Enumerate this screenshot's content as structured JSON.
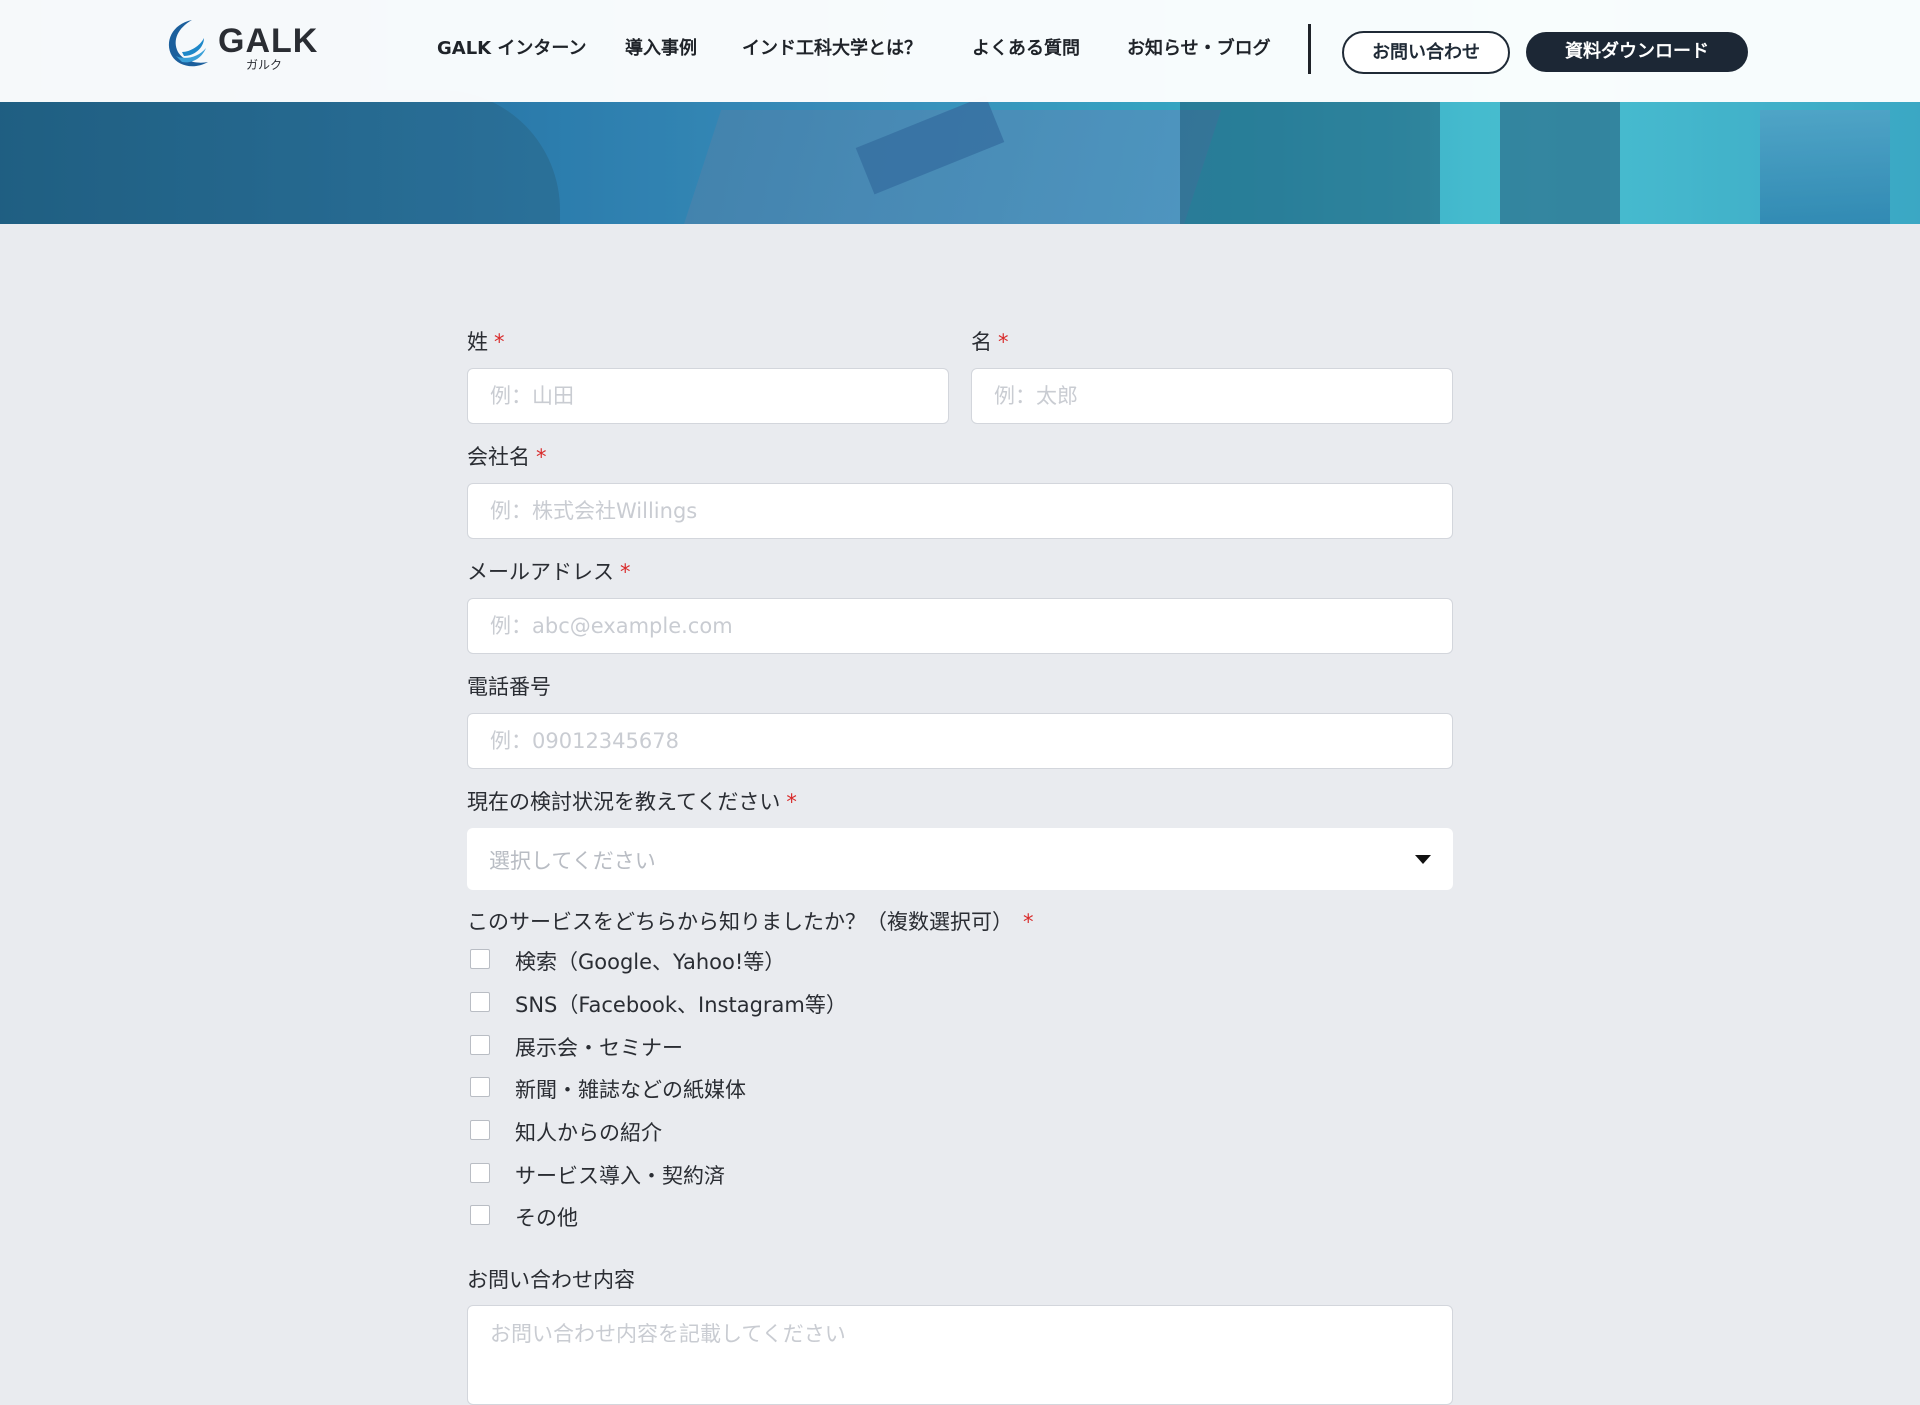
{
  "header": {
    "logo_text": "GALK",
    "logo_sub": "ガルク",
    "nav": [
      {
        "label": "GALK インターン"
      },
      {
        "label": "導入事例"
      },
      {
        "label": "インド工科大学とは？"
      },
      {
        "label": "よくある質問"
      },
      {
        "label": "お知らせ・ブログ"
      }
    ],
    "contact_label": "お問い合わせ",
    "download_label": "資料ダウンロード"
  },
  "form": {
    "last_name": {
      "label": "姓",
      "required": "*",
      "placeholder": "例：山田"
    },
    "first_name": {
      "label": "名",
      "required": "*",
      "placeholder": "例：太郎"
    },
    "company": {
      "label": "会社名",
      "required": "*",
      "placeholder": "例：株式会社Willings"
    },
    "email": {
      "label": "メールアドレス",
      "required": "*",
      "placeholder": "例：abc@example.com"
    },
    "phone": {
      "label": "電話番号",
      "placeholder": "例：09012345678"
    },
    "status": {
      "label": "現在の検討状況を教えてください",
      "required": "*",
      "placeholder": "選択してください"
    },
    "source": {
      "label": "このサービスをどちらから知りましたか？（複数選択可）",
      "required": "*",
      "options": [
        {
          "label": "検索（Google、Yahoo!等）",
          "checked": false
        },
        {
          "label": "SNS（Facebook、Instagram等）",
          "checked": false
        },
        {
          "label": "展示会・セミナー",
          "checked": false
        },
        {
          "label": "新聞・雑誌などの紙媒体",
          "checked": false
        },
        {
          "label": "知人からの紹介",
          "checked": false
        },
        {
          "label": "サービス導入・契約済",
          "checked": false
        },
        {
          "label": "その他",
          "checked": false
        }
      ]
    },
    "inquiry": {
      "label": "お問い合わせ内容",
      "placeholder": "お問い合わせ内容を記載してください"
    }
  },
  "colors": {
    "accent_dark": "#1c2735",
    "required": "#d92b2b",
    "page_bg": "#e9ebef"
  }
}
